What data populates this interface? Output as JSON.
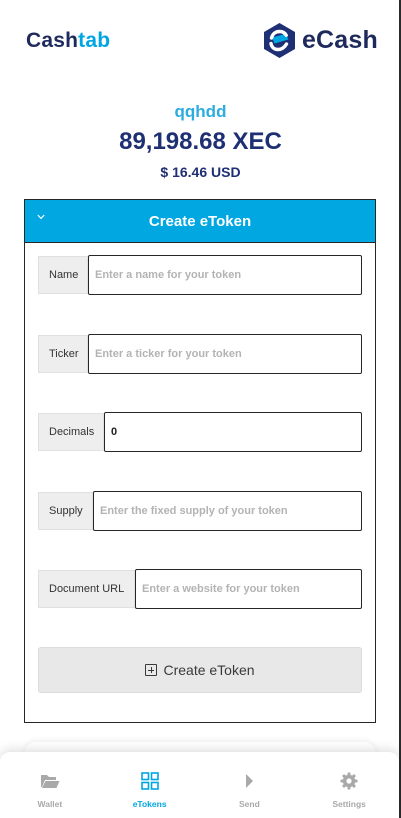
{
  "brand": {
    "cashtab_part1": "Cash",
    "cashtab_part2": "tab",
    "ecash_text": "eCash",
    "accent_color": "#01a7e1",
    "dark_color": "#1f2f73"
  },
  "wallet": {
    "name": "qqhdd",
    "balance_xec": "89,198.68 XEC",
    "balance_usd": "$ 16.46 USD"
  },
  "panel": {
    "title": "Create eToken",
    "chevron_icon": "chevron-down-icon",
    "fields": [
      {
        "label": "Name",
        "placeholder": "Enter a name for your token",
        "value": ""
      },
      {
        "label": "Ticker",
        "placeholder": "Enter a ticker for your token",
        "value": ""
      },
      {
        "label": "Decimals",
        "placeholder": "",
        "value": "0"
      },
      {
        "label": "Supply",
        "placeholder": "Enter the fixed supply of your token",
        "value": ""
      },
      {
        "label": "Document URL",
        "placeholder": "Enter a website for your token",
        "value": ""
      }
    ],
    "submit_label": "Create eToken",
    "submit_icon": "plus-square-icon"
  },
  "nav": {
    "active": "eTokens",
    "items": [
      {
        "label": "Wallet",
        "icon": "folder-open-icon"
      },
      {
        "label": "eTokens",
        "icon": "appstore-icon"
      },
      {
        "label": "Send",
        "icon": "caret-right-icon"
      },
      {
        "label": "Settings",
        "icon": "gear-icon"
      }
    ]
  }
}
